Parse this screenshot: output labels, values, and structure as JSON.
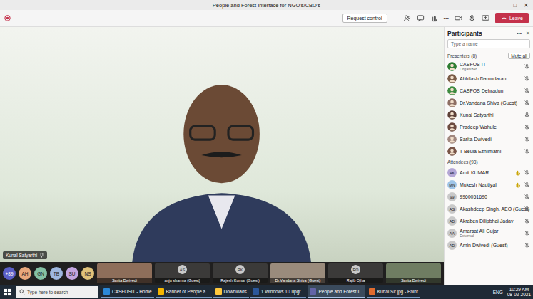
{
  "window": {
    "title": "People and Forest Interface for NGO's/CBO's",
    "controls": [
      "—",
      "□",
      "✕"
    ]
  },
  "meeting_bar": {
    "request_control": "Request control",
    "more": "•••",
    "leave": "Leave"
  },
  "main_video": {
    "speaker": "Kunal Satyarthi"
  },
  "participants": {
    "title": "Participants",
    "more": "•••",
    "close": "✕",
    "search_placeholder": "Type a name",
    "groups": [
      {
        "label": "Presenters (8)",
        "action": "Mute all",
        "people": [
          {
            "name": "CASFOS IT",
            "role": "Organizer",
            "kind": "photo",
            "color": "#2e7d32",
            "muted": true,
            "hand_raised": false
          },
          {
            "name": "Abhilash Damodaran",
            "kind": "photo",
            "color": "#7a5c48",
            "muted": true,
            "hand_raised": false
          },
          {
            "name": "CASFOS Dehradun",
            "kind": "photo",
            "color": "#3d8b40",
            "muted": true,
            "hand_raised": false
          },
          {
            "name": "Dr.Vandana Shiva (Guest)",
            "kind": "photo",
            "color": "#8d6e63",
            "muted": true,
            "hand_raised": false
          },
          {
            "name": "Kunal Satyarthi",
            "kind": "photo",
            "color": "#5d4037",
            "muted": false,
            "hand_raised": false
          },
          {
            "name": "Pradeep Wahule",
            "kind": "photo",
            "color": "#6d4c41",
            "muted": true,
            "hand_raised": false
          },
          {
            "name": "Sarita Dwivedi",
            "kind": "photo",
            "color": "#a1887f",
            "muted": true,
            "hand_raised": false
          },
          {
            "name": "T Beula Ezhilmathi",
            "kind": "photo",
            "color": "#795548",
            "muted": true,
            "hand_raised": false
          }
        ]
      },
      {
        "label": "Attendees (93)",
        "people": [
          {
            "name": "Amit KUMAR",
            "kind": "initials",
            "initials": "AK",
            "color": "#b4a7d6",
            "muted": true,
            "hand_raised": true
          },
          {
            "name": "Mukesh Nautiyal",
            "kind": "initials",
            "initials": "MN",
            "color": "#9fc5e8",
            "muted": true,
            "hand_raised": true
          },
          {
            "name": "9960051690",
            "kind": "initials",
            "initials": "99",
            "color": "#c9c9c9",
            "muted": true,
            "hand_raised": false
          },
          {
            "name": "Akashdeep Singh, AEO (Guest)",
            "kind": "initials",
            "initials": "AS",
            "color": "#c9c9c9",
            "muted": true,
            "hand_raised": false
          },
          {
            "name": "Akraben Dilipbhai Jadav",
            "kind": "initials",
            "initials": "AD",
            "color": "#c9c9c9",
            "muted": true,
            "hand_raised": false
          },
          {
            "name": "Amarsat Ali Gujar",
            "role": "External",
            "kind": "initials",
            "initials": "AA",
            "color": "#c9c9c9",
            "muted": true,
            "hand_raised": false
          },
          {
            "name": "Amin Dwivedi (Guest)",
            "kind": "initials",
            "initials": "AD",
            "color": "#c9c9c9",
            "muted": true,
            "hand_raised": false
          }
        ]
      }
    ]
  },
  "thumbnails": [
    {
      "kind": "count",
      "initials": "+89",
      "color": "#5b5fc7"
    },
    {
      "kind": "avatar",
      "initials": "AH",
      "color": "#e8a87c"
    },
    {
      "kind": "avatar",
      "initials": "GN",
      "color": "#85c1a4"
    },
    {
      "kind": "avatar",
      "initials": "TB",
      "color": "#9fb8e0"
    },
    {
      "kind": "avatar",
      "initials": "SU",
      "color": "#c3a6e0"
    },
    {
      "kind": "avatar",
      "initials": "NS",
      "color": "#e0c27a"
    },
    {
      "kind": "video",
      "name": "Sarita Dwivedi",
      "color": "#8e6e5a"
    },
    {
      "kind": "tile",
      "initials": "AS",
      "name": "anju sharma (Guest)",
      "color": "#c9c9c9"
    },
    {
      "kind": "tile",
      "initials": "RK",
      "name": "Rajesh Kumar (Guest)",
      "color": "#c9c9c9"
    },
    {
      "kind": "video",
      "name": "Dr.Vandana Shiva (Guest)",
      "color": "#9a8b7c"
    },
    {
      "kind": "tile",
      "initials": "RO",
      "name": "Rajib Ojha",
      "color": "#c9c9c9"
    },
    {
      "kind": "video",
      "name": "Sarita Dwivedi",
      "color": "#6f7d62"
    }
  ],
  "taskbar": {
    "search_placeholder": "Type here to search",
    "apps": [
      {
        "label": "CASFOSIT - Home",
        "active": false,
        "color": "#2b88d8"
      },
      {
        "label": "Banner of People a...",
        "active": false,
        "color": "#f4b400"
      },
      {
        "label": "Downloads",
        "active": false,
        "color": "#ffc83d"
      },
      {
        "label": "1.Windows 10 upgr...",
        "active": false,
        "color": "#2b579a"
      },
      {
        "label": "People and Forest I...",
        "active": true,
        "color": "#6264a7"
      },
      {
        "label": "Kunal Sir.jpg - Paint",
        "active": false,
        "color": "#e06c2f"
      }
    ],
    "language": "ENG",
    "time": "10:29 AM",
    "date": "08-02-2021"
  }
}
